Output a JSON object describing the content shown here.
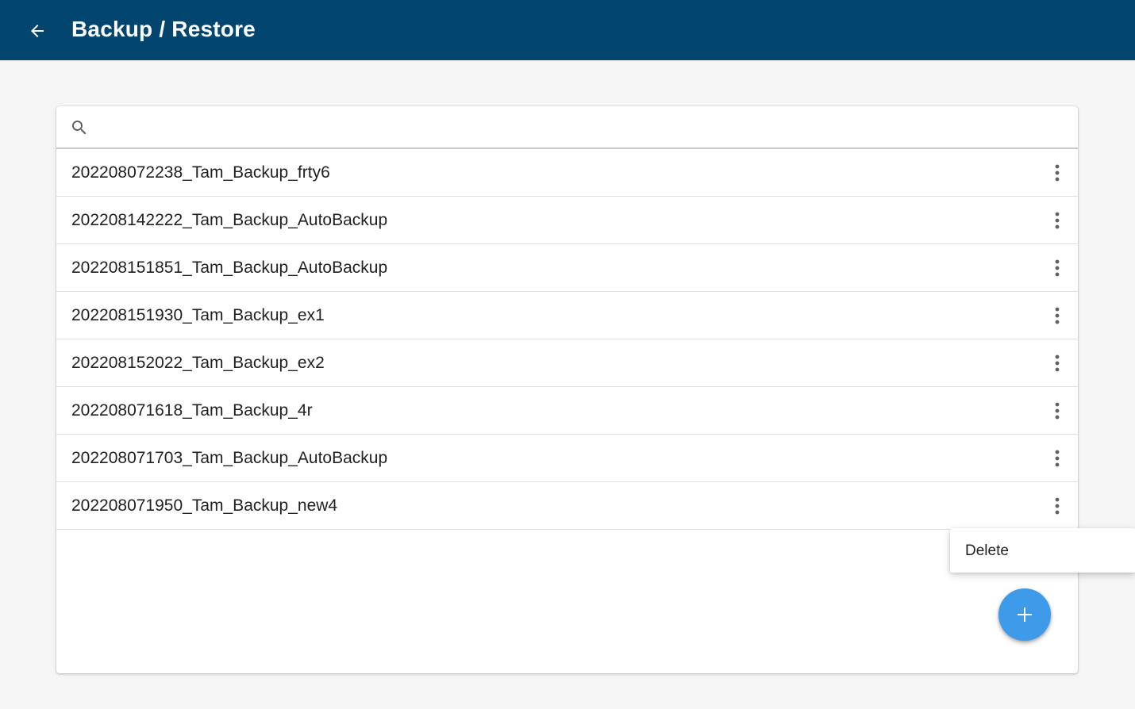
{
  "appbar": {
    "title": "Backup / Restore",
    "back_icon": "arrow-left-icon"
  },
  "search": {
    "placeholder": "",
    "value": "",
    "icon": "search-icon"
  },
  "backups": [
    {
      "name": "202208072238_Tam_Backup_frty6"
    },
    {
      "name": "202208142222_Tam_Backup_AutoBackup"
    },
    {
      "name": "202208151851_Tam_Backup_AutoBackup"
    },
    {
      "name": "202208151930_Tam_Backup_ex1"
    },
    {
      "name": "202208152022_Tam_Backup_ex2"
    },
    {
      "name": "202208071618_Tam_Backup_4r"
    },
    {
      "name": "202208071703_Tam_Backup_AutoBackup"
    },
    {
      "name": "202208071950_Tam_Backup_new4"
    }
  ],
  "row_menu_icon": "more-vertical-icon",
  "popup_menu": {
    "items": [
      {
        "label": "Delete"
      }
    ]
  },
  "fab": {
    "icon": "plus-icon"
  },
  "colors": {
    "appbar": "#02466f",
    "fab": "#3e9bea",
    "background": "#f5f5f5"
  }
}
